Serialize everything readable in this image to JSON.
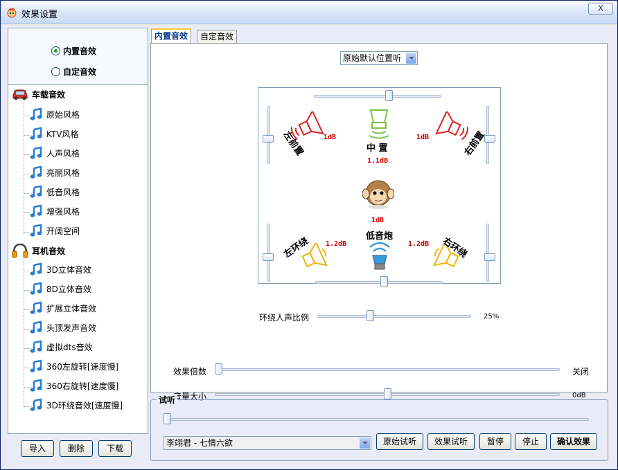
{
  "window": {
    "title": "效果设置",
    "close_label": "X"
  },
  "mode": {
    "builtin_label": "内置音效",
    "custom_label": "自定音效",
    "selected": "builtin"
  },
  "tree": {
    "car_label": "车载音效",
    "car_items": [
      "原始风格",
      "KTV风格",
      "人声风格",
      "亮丽风格",
      "低音风格",
      "增强风格",
      "开阔空间"
    ],
    "headphone_label": "耳机音效",
    "headphone_items": [
      "3D立体音效",
      "8D立体音效",
      "扩展立体音效",
      "头顶发声音效",
      "虚拟dts音效",
      "360左旋转[速度慢]",
      "360右旋转[速度慢]",
      "3D环绕音效[速度慢]"
    ]
  },
  "left_buttons": {
    "import": "导入",
    "delete": "删除",
    "download": "下载"
  },
  "tabs": {
    "builtin": "内置音效",
    "custom": "自定音效"
  },
  "position_select": {
    "value": "原始默认位置听"
  },
  "speakers": {
    "front_left": {
      "label": "左前置",
      "db": "1dB"
    },
    "center": {
      "label": "中 置",
      "db": "1.1dB"
    },
    "front_right": {
      "label": "右前置",
      "db": "1dB"
    },
    "sub": {
      "label": "低音炮",
      "db": "1dB"
    },
    "rear_left": {
      "label": "左环绕",
      "db": "1.2dB"
    },
    "rear_right": {
      "label": "右环绕",
      "db": "1.2dB"
    }
  },
  "surround_ratio": {
    "label": "环绕人声比例",
    "value_text": "25%",
    "value": 0.25
  },
  "effect_multiplier": {
    "label": "效果倍数",
    "value_text": "关闭",
    "value": 0.0
  },
  "volume": {
    "label": "音量大小",
    "value_text": "0dB",
    "value": 0.5
  },
  "preview": {
    "group_label": "试听",
    "progress": 0.0,
    "track": "李翊君 - 七情六欲",
    "buttons": {
      "original": "原始试听",
      "effect": "效果试听",
      "pause": "暂停",
      "stop": "停止",
      "confirm": "确认效果"
    }
  },
  "colors": {
    "speaker_red": "#e02020",
    "speaker_green": "#7cc242",
    "speaker_yellow": "#f0b400",
    "speaker_blue": "#3a9ad9",
    "db_red": "#cc0000"
  }
}
